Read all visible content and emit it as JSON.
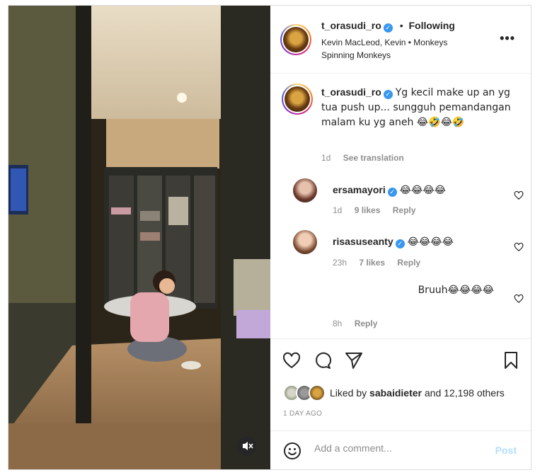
{
  "header": {
    "username": "t_orasudi_ro",
    "separator": "•",
    "following_label": "Following",
    "audio_artist": "Kevin MacLeod, Kevin",
    "audio_track": "Monkeys Spinning Monkeys"
  },
  "caption": {
    "username": "t_orasudi_ro",
    "text": "Yg kecil make up an yg tua push up... sungguh pemandangan malam ku yg aneh 😂🤣😂🤣",
    "time": "1d",
    "translate_label": "See translation"
  },
  "comments": [
    {
      "username": "ersamayori",
      "text": "😂😂😂😂",
      "time": "1d",
      "likes": "9 likes",
      "reply": "Reply"
    },
    {
      "username": "risasuseanty",
      "text": "😂😂😂😂",
      "time": "23h",
      "likes": "7 likes",
      "reply": "Reply"
    },
    {
      "username": "",
      "text": "Bruuh😂😂😂😂",
      "time": "8h",
      "likes": "",
      "reply": "Reply"
    }
  ],
  "likes": {
    "prefix": "Liked by",
    "user": "sabaidieter",
    "suffix": "and 12,198 others"
  },
  "posted_ago": "1 DAY AGO",
  "add_comment": {
    "placeholder": "Add a comment...",
    "post_label": "Post"
  },
  "colors": {
    "accent": "#3897f0",
    "post_disabled": "#b2dffc"
  },
  "icons": [
    "ellipsis-icon",
    "heart-icon",
    "comment-icon",
    "share-icon",
    "bookmark-icon",
    "emoji-icon",
    "mute-icon",
    "verified-icon"
  ]
}
